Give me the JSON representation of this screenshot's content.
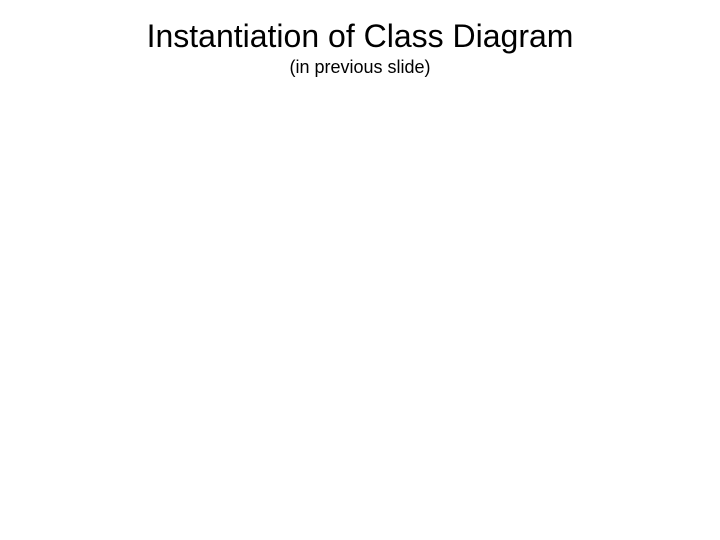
{
  "slide": {
    "title": "Instantiation of Class Diagram",
    "subtitle": "(in previous slide)"
  }
}
